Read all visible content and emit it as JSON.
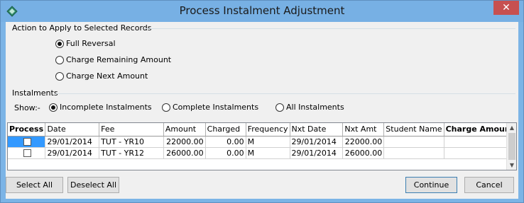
{
  "window": {
    "title": "Process Instalment Adjustment",
    "close_glyph": "✕"
  },
  "action_group": {
    "label": "Action to Apply to Selected Records",
    "options": [
      {
        "label": "Full Reversal",
        "selected": true
      },
      {
        "label": "Charge Remaining Amount",
        "selected": false
      },
      {
        "label": "Charge Next Amount",
        "selected": false
      }
    ]
  },
  "instalments_group": {
    "label": "Instalments",
    "show_label": "Show:-",
    "options": [
      {
        "label": "Incomplete Instalments",
        "selected": true
      },
      {
        "label": "Complete Instalments",
        "selected": false
      },
      {
        "label": "All Instalments",
        "selected": false
      }
    ]
  },
  "grid": {
    "columns": [
      "Process",
      "Date",
      "Fee",
      "Amount",
      "Charged",
      "Frequency",
      "Nxt Date",
      "Nxt Amt",
      "Student Name",
      "Charge Amount"
    ],
    "rows": [
      {
        "process": false,
        "date": "29/01/2014",
        "fee": "TUT - YR10",
        "amount": "22000.00",
        "charged": "0.00",
        "frequency": "M",
        "nxt_date": "29/01/2014",
        "nxt_amt": "22000.00",
        "student_name": "",
        "charge_amount": ""
      },
      {
        "process": false,
        "date": "29/01/2014",
        "fee": "TUT - YR12",
        "amount": "26000.00",
        "charged": "0.00",
        "frequency": "M",
        "nxt_date": "29/01/2014",
        "nxt_amt": "26000.00",
        "student_name": "",
        "charge_amount": ""
      }
    ]
  },
  "buttons": {
    "select_all": "Select All",
    "deselect_all": "Deselect All",
    "continue": "Continue",
    "cancel": "Cancel"
  }
}
